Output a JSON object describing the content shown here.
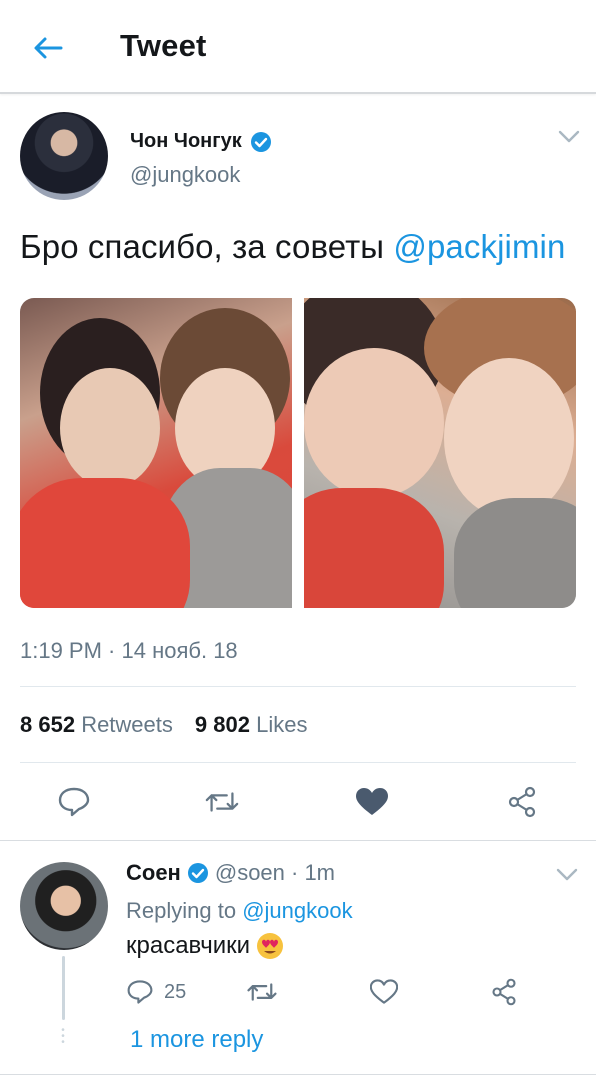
{
  "header": {
    "title": "Tweet",
    "back_icon": "arrow-left-icon"
  },
  "tweet": {
    "author_name": "Чон Чонгук",
    "author_handle": "@jungkook",
    "text": "Бро спасибо, за советы ",
    "mention": "@packjimin",
    "timestamp": "1:19 PM · 14 нояб. 18",
    "retweets_count": "8 652",
    "retweets_label": "Retweets",
    "likes_count": "9 802",
    "likes_label": "Likes"
  },
  "reply": {
    "name": "Соен",
    "handle": "@soen · 1m",
    "replying_prefix": "Replying to ",
    "replying_handle": "@jungkook",
    "text": "красавчики",
    "reply_count": "25",
    "more_replies": "1 more reply"
  },
  "colors": {
    "accent": "#1b95e0",
    "text_primary": "#14171a",
    "text_secondary": "#657786",
    "divider": "#e1e8ed",
    "liked_heart": "#4a5a6e"
  }
}
